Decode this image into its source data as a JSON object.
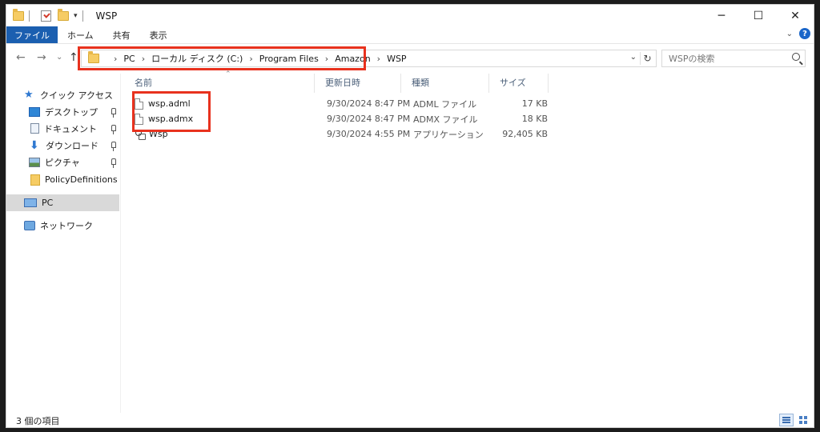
{
  "window": {
    "title": "WSP"
  },
  "window_controls": {
    "minimize": "─",
    "maximize": "☐",
    "close": "✕"
  },
  "ribbon": {
    "tabs": [
      "ファイル",
      "ホーム",
      "共有",
      "表示"
    ],
    "collapse_glyph": "⌄",
    "help": "?"
  },
  "nav": {
    "back": "←",
    "forward": "→",
    "recent": "⌄",
    "up": "↑"
  },
  "address": {
    "crumbs": [
      "PC",
      "ローカル ディスク (C:)",
      "Program Files",
      "Amazon",
      "WSP"
    ],
    "separator": "›",
    "dropdown": "⌄",
    "refresh": "↻"
  },
  "search": {
    "placeholder": "WSPの検索"
  },
  "sidebar": {
    "quick_access": "クイック アクセス",
    "items": [
      {
        "label": "デスクトップ",
        "pinned": true
      },
      {
        "label": "ドキュメント",
        "pinned": true
      },
      {
        "label": "ダウンロード",
        "pinned": true
      },
      {
        "label": "ピクチャ",
        "pinned": true
      },
      {
        "label": "PolicyDefinitions",
        "pinned": false
      }
    ],
    "pc": "PC",
    "network": "ネットワーク"
  },
  "columns": [
    "名前",
    "更新日時",
    "種類",
    "サイズ"
  ],
  "files": [
    {
      "name": "wsp.adml",
      "date": "9/30/2024 8:47 PM",
      "type": "ADML ファイル",
      "size": "17 KB",
      "icon": "document-icon"
    },
    {
      "name": "wsp.admx",
      "date": "9/30/2024 8:47 PM",
      "type": "ADMX ファイル",
      "size": "18 KB",
      "icon": "document-icon"
    },
    {
      "name": "Wsp",
      "date": "9/30/2024 4:55 PM",
      "type": "アプリケーション",
      "size": "92,405 KB",
      "icon": "application-icon"
    }
  ],
  "status": {
    "item_count": "3 個の項目"
  },
  "colors": {
    "accent": "#1b5fb0",
    "highlight": "#e8321e",
    "folder": "#f6cc64"
  }
}
